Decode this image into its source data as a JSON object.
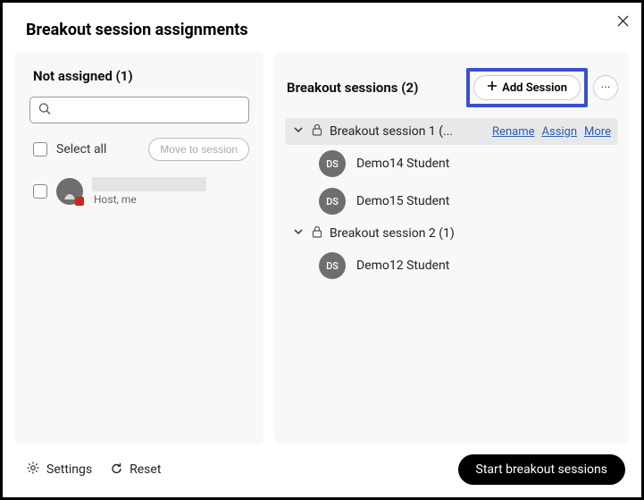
{
  "title": "Breakout session assignments",
  "left": {
    "title": "Not assigned (1)",
    "search_placeholder": "",
    "select_all": "Select all",
    "move_btn": "Move to session",
    "participant": {
      "sub": "Host, me"
    }
  },
  "right": {
    "title": "Breakout sessions  (2)",
    "add_session": "Add Session",
    "sessions": [
      {
        "name": "Breakout session 1 (...",
        "links": {
          "rename": "Rename",
          "assign": "Assign",
          "more": "More"
        },
        "students": [
          {
            "initials": "DS",
            "name": "Demo14 Student"
          },
          {
            "initials": "DS",
            "name": "Demo15 Student"
          }
        ]
      },
      {
        "name": "Breakout session 2 (1)",
        "students": [
          {
            "initials": "DS",
            "name": "Demo12 Student"
          }
        ]
      }
    ]
  },
  "footer": {
    "settings": "Settings",
    "reset": "Reset",
    "start": "Start breakout sessions"
  }
}
